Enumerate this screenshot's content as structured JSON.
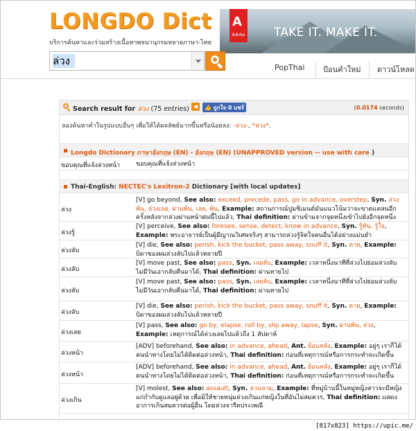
{
  "header": {
    "logo": "LONGDO Dict",
    "tagline": "บริการค้นหาและร่วมสร้างเนื้อหาพจนานุกรมหลายภาษา-ไทย",
    "ad": {
      "brand": "Adobe",
      "slogan": "TAKE IT. MAKE IT."
    }
  },
  "search": {
    "value": "ล่วง"
  },
  "nav": {
    "items": [
      "PopThai",
      "ป้อนคำใหม่",
      "ดาวน์โหลด"
    ]
  },
  "results": {
    "prefix": "Search result for",
    "query": "ล่วง",
    "count": "(75 entries)",
    "like_label": "ถูกใจ 0",
    "share_label": "แชร์",
    "timing_open": "(",
    "timing_value": "0.0174",
    "timing_close": " seconds)",
    "hint_text": "ลองค้นหาคำในรูปแบบอื่นๆ เพื่อให้ได้ผลลัพธ์มากขึ้นหรือน้อยลง:",
    "hint_link1": "-ล่วง-",
    "hint_link2": "*ล่วง*",
    "hint_sep": ", ",
    "hint_end": "."
  },
  "section1": {
    "title": "Longdo Dictionary ภาษาอังกฤษ (EN) - อังกฤษ (EN) (UNAPPROVED version --",
    "warn": "use with care",
    "close": ")",
    "rows": [
      {
        "head": "ขอบคุณที่แจ้งล่วงหน้า",
        "def": "ขอบคุณที่แจ้งล่วงหน้า"
      }
    ]
  },
  "section2": {
    "prefix": "Thai-English:",
    "source": "NECTEC's Lexitron-2",
    "suffix": "Dictionary [with local updates]"
  },
  "entries": [
    {
      "head": "ล่วง",
      "html": "[V] go beyond, <b>See also:</b> <span class=\"o\">exceed, precede, pass, go in advance, overstep</span>, <b>Syn.</b> <span class=\"o\">ล่วงพ้น, ล่วงเลย, ผ่านพ้น, เลย, พ้น</span>, <b>Example:</b> สถานการณ์ปูมชิเมนต์มันแนวโน้มว่าจะขาดแคลนอีกครั้งหลังจากล่วงผ่านหน้าฝนนี้ไปแล้ว, <b>Thai definition:</b> ผ่านข้ามจากจุดหนึ่งเข้าไปยังอีกจุดหนึ่ง"
    },
    {
      "head": "ล่วงรู้",
      "html": "[V] perceive, <b>See also:</b> <span class=\"o\">foresee, sense, detect, know in advance</span>, <b>Syn.</b> <span class=\"o\">รู้ทัน, รู้ใจ</span>, <b>Example:</b> พระอาจารย์เป็นผู้มีญาณวิเศษจริงๆ สามารถล่วงรู้จิตใจคนอื่นได้อย่างแม่นยำ"
    },
    {
      "head": "ล่วงลับ",
      "html": "[V] die, <b>See also:</b> <span class=\"o\">perish, kick the bucket, pass away, snuff it</span>, <b>Syn.</b> <span class=\"o\">ตาย</span>, <b>Example:</b> บิดาของผมล่วงลับไปแล้วหลายปี"
    },
    {
      "head": "ล่วงลับ",
      "html": "[V] move past, <b>See also:</b> <span class=\"o\">pass</span>, <b>Syn.</b> <span class=\"o\">เลยลับ</span>, <b>Example:</b> เวลาหนึ่งนาทีที่ล่วงไปย่อมล่วงลับไม่มีวันเอากลับคืนมาได้, <b>Thai definition:</b> ผ่านหายไป"
    },
    {
      "head": "ล่วงลับ",
      "html": "[V] move past, <b>See also:</b> <span class=\"o\">pass</span>, <b>Syn.</b> <span class=\"o\">เลยลับ</span>, <b>Example:</b> เวลาหนึ่งนาทีที่ล่วงไปย่อมล่วงลับไม่มีวันเอากลับคืนมาได้, <b>Thai definition:</b> ผ่านหายไป"
    },
    {
      "head": "ล่วงลับ",
      "html": "[V] die, <b>See also:</b> <span class=\"o\">perish, kick the bucket, pass away, snuff it</span>, <b>Syn.</b> <span class=\"o\">ตาย</span>, <b>Example:</b> บิดาของผมล่วงลับไปแล้วหลายปี"
    },
    {
      "head": "ล่วงเลย",
      "html": "[V] pass, <b>See also:</b> <span class=\"o\">go by, elapse, roll by, slip away, lapse</span>, <b>Syn.</b> <span class=\"o\">ผ่านพ้น, ล่วง</span>, <b>Example:</b> เหตุการณ์ได้ล่วงเลยไปแล้วถึง 1 สัปดาห์"
    },
    {
      "head": "ล่วงหน้า",
      "html": "[ADV] beforehand, <b>See also:</b> <span class=\"o\">in advance, ahead</span>, <b>Ant.</b> <span class=\"o\">ย้อนหลัง</span>, <b>Example:</b> อยู่ๆ เราก็ได้คนนำทางโดยไม่ได้ติดต่อล่วงหน้า, <b>Thai definition:</b> ก่อนที่เหตุการณ์หรือการกระทำจะเกิดขึ้น"
    },
    {
      "head": "ล่วงหน้า",
      "html": "[ADV] beforehand, <b>See also:</b> <span class=\"o\">in advance, ahead</span>, <b>Ant.</b> <span class=\"o\">ย้อนหลัง</span>, <b>Example:</b> อยู่ๆ เราก็ได้คนนำทางโดยไม่ได้ติดต่อล่วงหน้า, <b>Thai definition:</b> ก่อนที่เหตุการณ์หรือการกระทำจะเกิดขึ้น"
    },
    {
      "head": "ล่วงเกิน",
      "html": "[V] molest, <b>See also:</b> <span class=\"o\">assault</span>, <b>Syn.</b> <span class=\"o\">ลวนลาม</span>, <b>Example:</b> ที่หมู่บ้านนี้ในหมู่หญิงสาวจะมีหญิงแก่กำกับดูแลอยู่ด้วย เพื่อมิให้ชายหนุ่มล่วงเกินแก่หญิงในที่อันไม่สมควร, <b>Thai definition:</b> แสดงอาการเกินสมควรต่อผู้อื่น โดยล่วงจารีตประเพณี"
    }
  ],
  "footer": {
    "caption": "[817x823] https://upic.me/"
  }
}
